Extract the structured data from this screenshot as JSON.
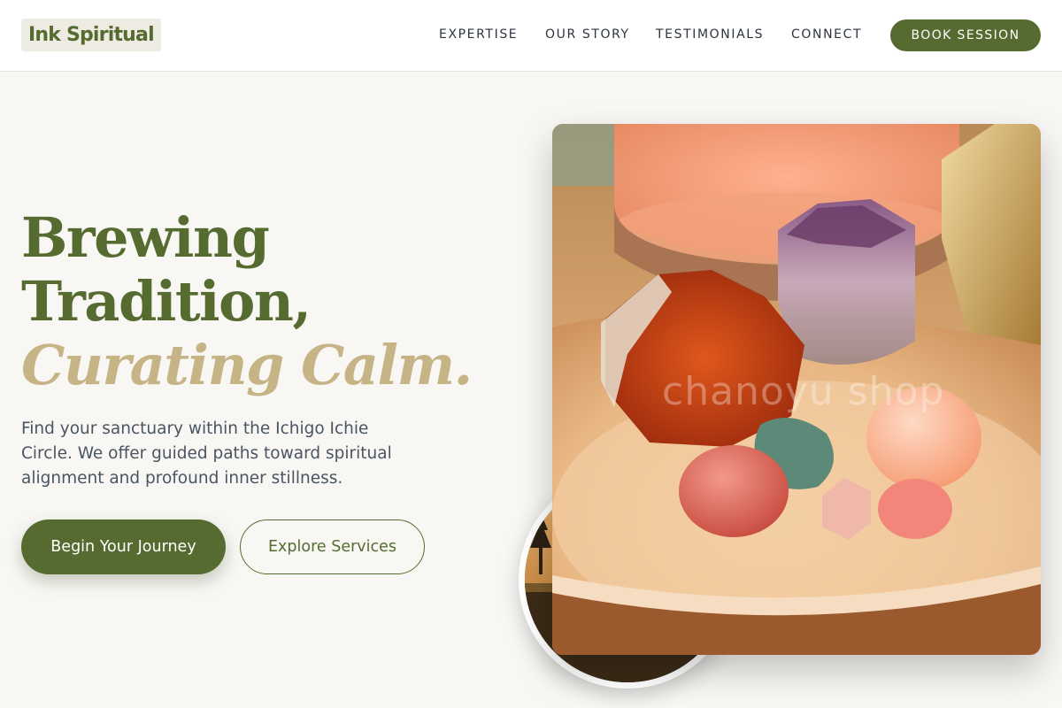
{
  "brand": {
    "logo_text": "Ink Spiritual",
    "primary_color": "#556b2f",
    "accent_color": "#c6b487",
    "background": "#f8f7f4"
  },
  "nav": {
    "links": [
      {
        "label": "EXPERTISE"
      },
      {
        "label": "OUR STORY"
      },
      {
        "label": "TESTIMONIALS"
      },
      {
        "label": "CONNECT"
      }
    ],
    "cta_label": "BOOK SESSION"
  },
  "hero": {
    "headline_line1": "Brewing",
    "headline_line2": "Tradition,",
    "headline_accent": "Curating Calm.",
    "subtitle": "Find your sanctuary within the Ichigo Ichie Circle. We offer guided paths toward spiritual alignment and profound inner stillness.",
    "primary_cta": "Begin Your Journey",
    "secondary_cta": "Explore Services",
    "image_watermark": "chanoyu shop"
  }
}
